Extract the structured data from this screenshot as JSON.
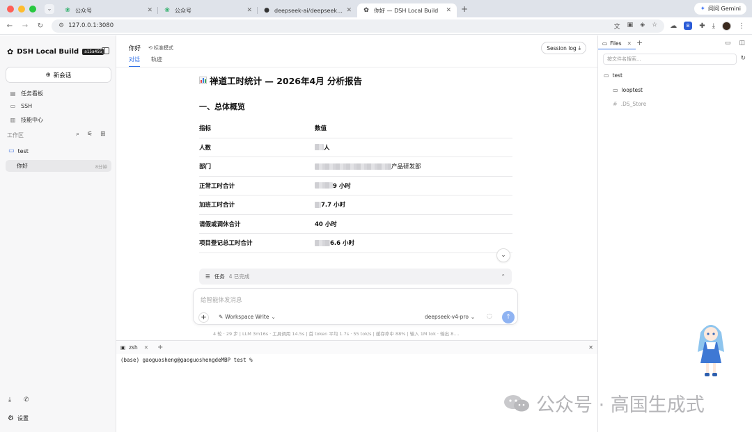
{
  "browser": {
    "tabs": [
      {
        "title": "公众号",
        "icon": "wechat-icon"
      },
      {
        "title": "公众号",
        "icon": "wechat-icon"
      },
      {
        "title": "deepseek-ai/deepseek-harn",
        "icon": "github-icon"
      },
      {
        "title": "你好 — DSH Local Build",
        "icon": "app-logo-icon"
      }
    ],
    "gemini_label": "问问 Gemini",
    "url": "127.0.0.1:3080"
  },
  "sidebar": {
    "brand": "DSH Local Build",
    "version": "a15a455",
    "new_chat": "新会话",
    "nav": [
      "任务看板",
      "SSH",
      "技能中心"
    ],
    "workspace_label": "工作区",
    "folder": "test",
    "session": {
      "title": "你好",
      "time": "8分钟"
    },
    "settings": "设置"
  },
  "header": {
    "title": "你好",
    "mode": "标准模式",
    "tabs": [
      "对话",
      "轨迹"
    ],
    "session_log": "Session log"
  },
  "doc": {
    "title": "禅道工时统计 — 2026年4月 分析报告",
    "section": "一、总体概览",
    "table_head": [
      "指标",
      "数值"
    ],
    "rows": [
      {
        "label": "人数",
        "value": "人"
      },
      {
        "label": "部门",
        "value": "产品研发部"
      },
      {
        "label": "正常工时合计",
        "value": "9 小时"
      },
      {
        "label": "加班工时合计",
        "value": "7.7 小时"
      },
      {
        "label": "请假或调休合计",
        "value": "40 小时"
      },
      {
        "label": "项目登记总工时合计",
        "value": "6.6 小时"
      }
    ]
  },
  "tasks": {
    "label": "任务",
    "count": "4 已完成"
  },
  "composer": {
    "placeholder": "给智能体发消息",
    "permission": "Workspace Write",
    "model": "deepseek-v4-pro"
  },
  "stats": "4 轮 · 29 步 | LLM 3m16s · 工具调用 14.5s | 首 token 平均 1.7s · 55 tok/s | 缓存命中 88% | 输入 1M tok · 输出 8....",
  "terminal": {
    "tab": "zsh",
    "line": "(base) gaoguosheng@gaoguoshengdeMBP test %"
  },
  "files": {
    "tab": "Files",
    "search_placeholder": "按文件名搜索...",
    "tree": [
      {
        "name": "test",
        "depth": 0,
        "kind": "folder"
      },
      {
        "name": "looptest",
        "depth": 1,
        "kind": "folder"
      },
      {
        "name": ".DS_Store",
        "depth": 1,
        "kind": "file"
      }
    ]
  },
  "watermark": "公众号 · 高国生成式",
  "colors": {
    "accent": "#2d6fe8",
    "folder": "#3b6fe0",
    "send": "#8fb3f2"
  }
}
